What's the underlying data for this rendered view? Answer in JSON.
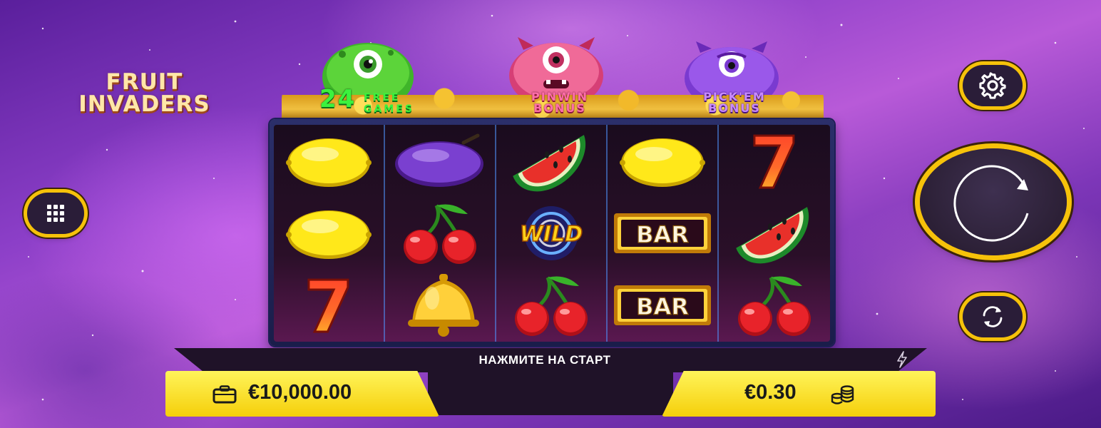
{
  "game": {
    "logo_line1": "FRUIT",
    "logo_line2": "INVADERS"
  },
  "bonuses": [
    {
      "big": "24",
      "small_line1": "FREE",
      "small_line2": "GAMES",
      "color": "#3bf23e",
      "monster": "green-monster-icon"
    },
    {
      "line1": "PINWIN",
      "line2": "BONUS",
      "color": "#ff6fa8",
      "monster": "pink-monster-icon"
    },
    {
      "line1": "PICK'EM",
      "line2": "BONUS",
      "color": "#c88aff",
      "monster": "purple-monster-icon"
    }
  ],
  "reels": [
    [
      "lemon",
      "lemon",
      "seven"
    ],
    [
      "plum",
      "cherry",
      "bell"
    ],
    [
      "watermelon",
      "wild",
      "cherry"
    ],
    [
      "lemon",
      "bar",
      "bar"
    ],
    [
      "seven",
      "watermelon",
      "cherry"
    ]
  ],
  "symbols": {
    "wild_text": "WILD",
    "bar_text": "BAR",
    "seven_text": "7"
  },
  "status": {
    "message": "НАЖМИТЕ НА СТАРТ"
  },
  "balance": {
    "value": "€10,000.00",
    "icon": "wallet-icon"
  },
  "bet": {
    "value": "€0.30",
    "icon": "coin-stack-icon"
  },
  "controls": {
    "menu_icon": "grid-menu-icon",
    "settings_icon": "gear-icon",
    "spin_icon": "spin-arrow-icon",
    "autoplay_icon": "autoplay-arrows-icon"
  },
  "colors": {
    "accent_yellow": "#f6c20a",
    "reel_divider": "#5096ff",
    "button_dark": "#2a1d38"
  }
}
